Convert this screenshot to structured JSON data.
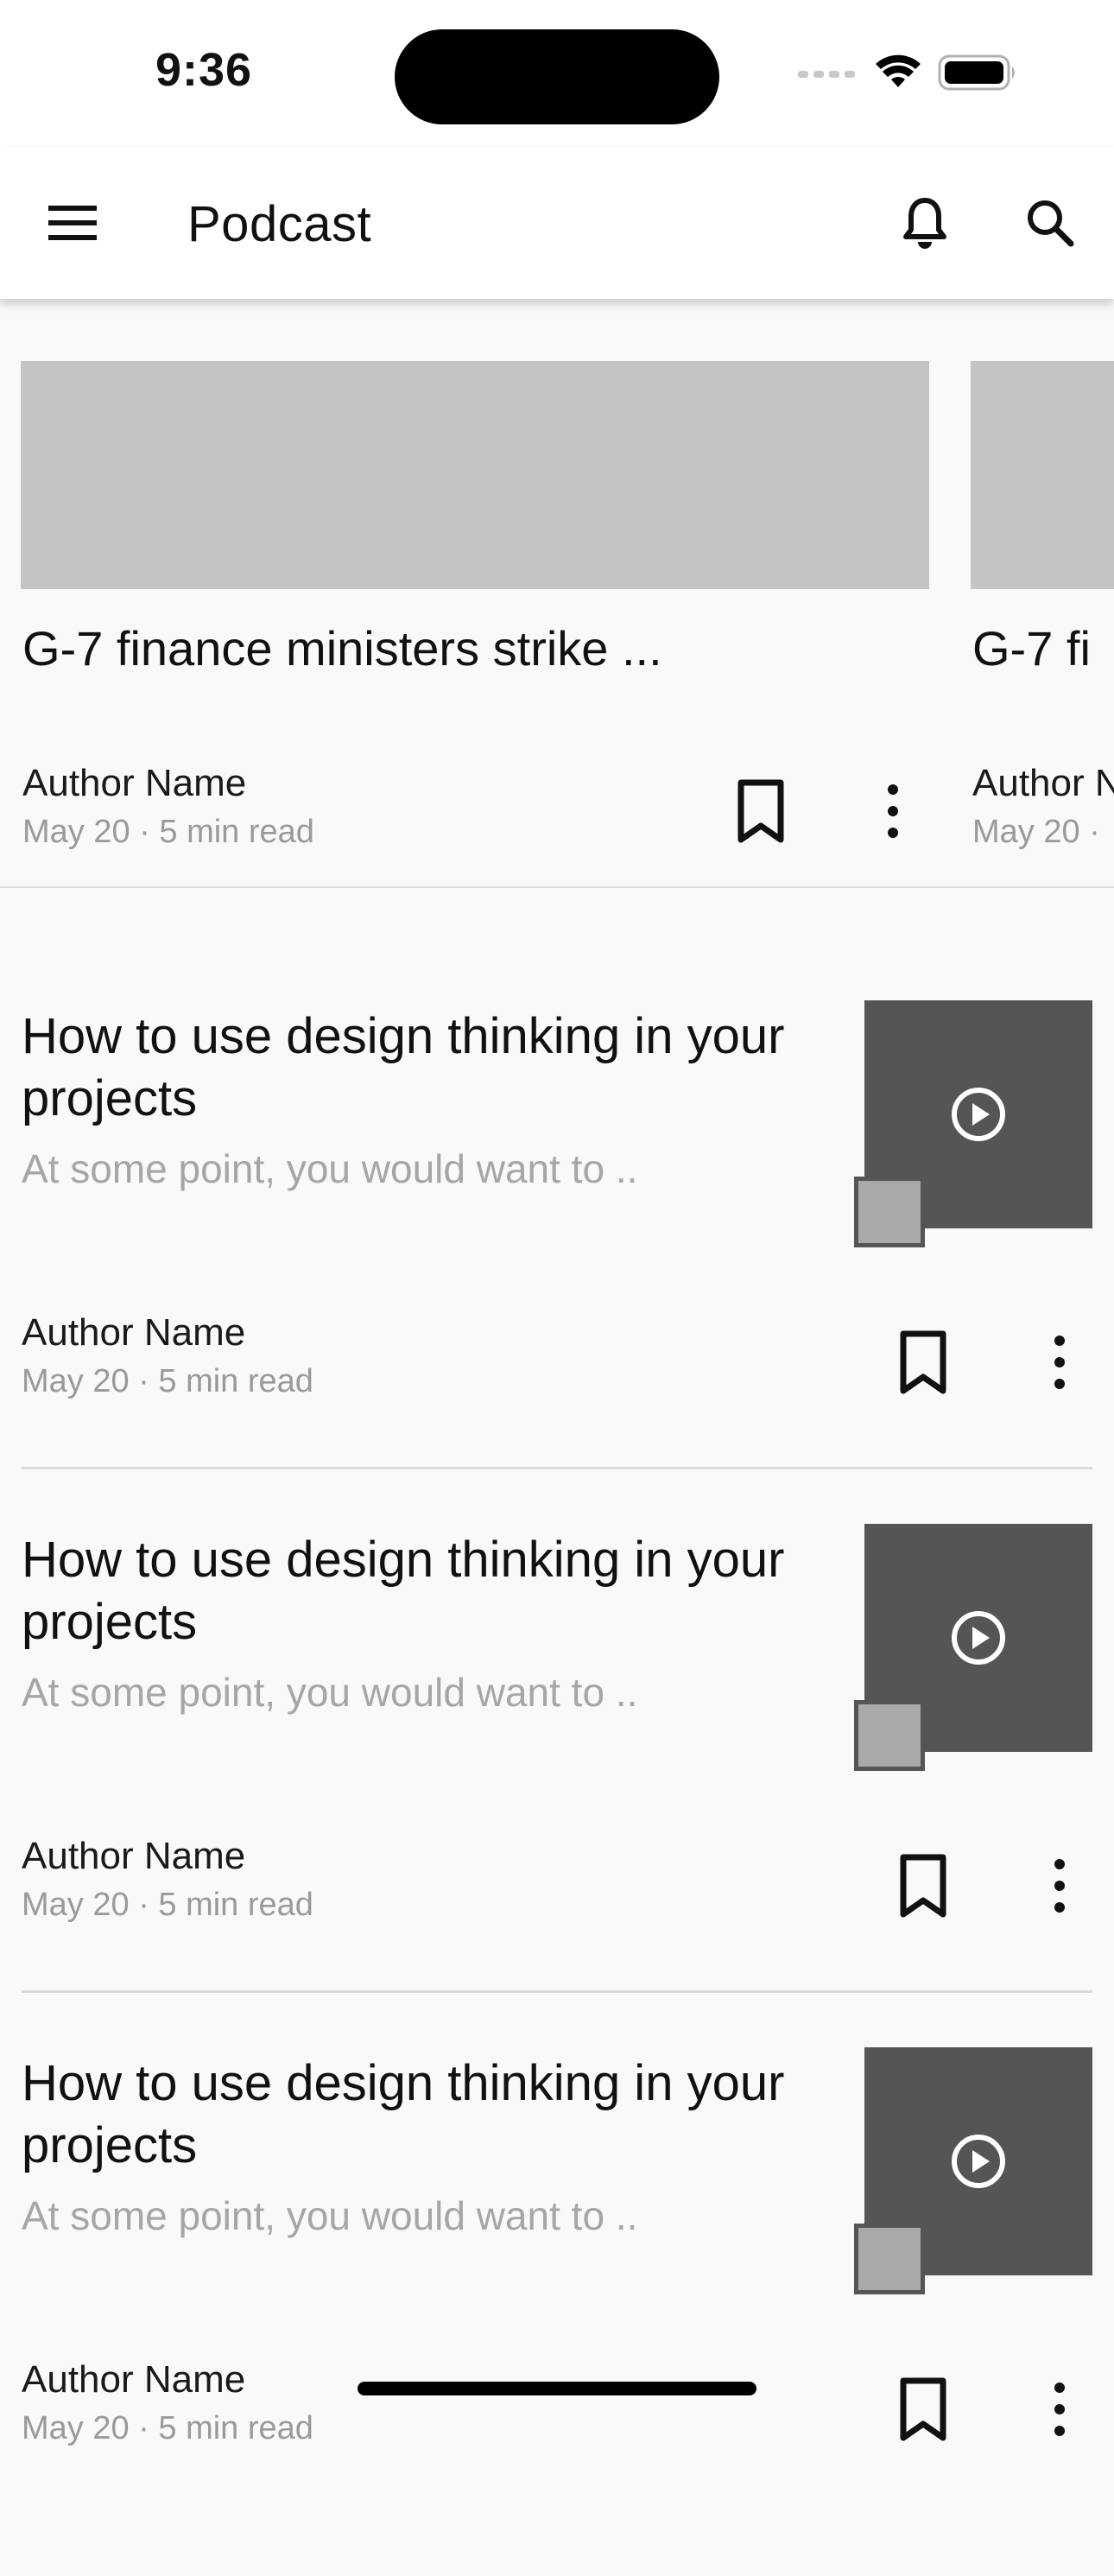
{
  "status_bar": {
    "time": "9:36"
  },
  "app_bar": {
    "title": "Podcast",
    "icons": [
      "menu-icon",
      "bell-icon",
      "search-icon"
    ]
  },
  "carousel": {
    "cards": [
      {
        "title": "G-7 finance ministers strike ...",
        "author": "Author Name",
        "meta": "May 20 · 5 min read"
      },
      {
        "title": "G-7 fi",
        "author": "Author N",
        "meta": "May 20 ·"
      }
    ]
  },
  "list": {
    "items": [
      {
        "title": "How to use design thinking in your projects",
        "description": "At some point, you would want to ..",
        "author": "Author Name",
        "meta": "May 20 · 5 min read"
      },
      {
        "title": "How to use design thinking in your projects",
        "description": "At some point, you would want to ..",
        "author": "Author Name",
        "meta": "May 20 · 5 min read"
      },
      {
        "title": "How to use design thinking in your projects",
        "description": "At some point, you would want to ..",
        "author": "Author Name",
        "meta": "May 20 · 5 min read"
      }
    ]
  },
  "colors": {
    "background": "#f9f9f9",
    "app_bar": "#ffffff",
    "placeholder": "#c4c4c4",
    "media_dark": "#555555",
    "muted_text": "#9a9a9a"
  }
}
